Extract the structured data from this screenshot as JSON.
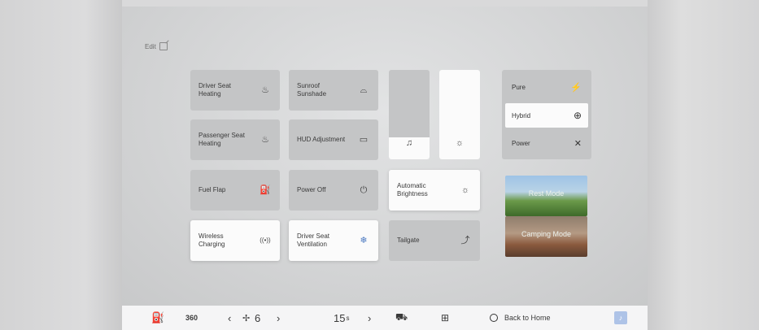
{
  "header": {
    "edit_label": "Edit"
  },
  "tiles": [
    {
      "id": "driver-seat-heating",
      "label": "Driver Seat Heating",
      "icon": "seat-heat-icon",
      "glyph": "♨",
      "active": false
    },
    {
      "id": "sunroof-sunshade",
      "label": "Sunroof Sunshade",
      "icon": "sunroof-icon",
      "glyph": "⛟",
      "active": false
    },
    {
      "id": "passenger-seat-heating",
      "label": "Passenger Seat Heating",
      "icon": "passenger-seat-icon",
      "glyph": "♨",
      "active": false
    },
    {
      "id": "hud-adjustment",
      "label": "HUD Adjustment",
      "icon": "hud-icon",
      "glyph": "▭",
      "active": false
    },
    {
      "id": "fuel-flap",
      "label": "Fuel Flap",
      "icon": "fuel-flap-icon",
      "glyph": "⛽",
      "active": false
    },
    {
      "id": "power-off",
      "label": "Power Off",
      "icon": "power-icon",
      "glyph": "⏻",
      "active": false
    },
    {
      "id": "automatic-brightness",
      "label": "Automatic Brightness",
      "icon": "brightness-icon",
      "glyph": "☼",
      "active": true
    },
    {
      "id": "wireless-charging",
      "label": "Wireless Charging",
      "icon": "wireless-icon",
      "glyph": "((•))",
      "active": true
    },
    {
      "id": "driver-seat-ventilation",
      "label": "Driver Seat Ventilation",
      "icon": "seat-vent-icon",
      "glyph": "❄",
      "active": true
    },
    {
      "id": "tailgate",
      "label": "Tailgate",
      "icon": "tailgate-icon",
      "glyph": "⤴",
      "active": false
    }
  ],
  "sliders": {
    "volume": {
      "icon": "music-note-icon",
      "glyph": "♫",
      "level": 0.25
    },
    "brightness": {
      "icon": "sun-icon",
      "glyph": "☼",
      "level": 1.0
    }
  },
  "modes": [
    {
      "label": "Pure",
      "icon": "bolt-icon",
      "glyph": "⚡",
      "active": false
    },
    {
      "label": "Hybrid",
      "icon": "hybrid-icon",
      "glyph": "⊕",
      "active": true
    },
    {
      "label": "Power",
      "icon": "power-mode-icon",
      "glyph": "✕",
      "active": false
    }
  ],
  "scenes": {
    "rest": "Rest Mode",
    "camping": "Camping Mode"
  },
  "bottom_bar": {
    "icon_360_label": "360",
    "fan_level": "6",
    "timer_value": "15",
    "timer_unit": "s",
    "home_label": "Back to Home"
  }
}
